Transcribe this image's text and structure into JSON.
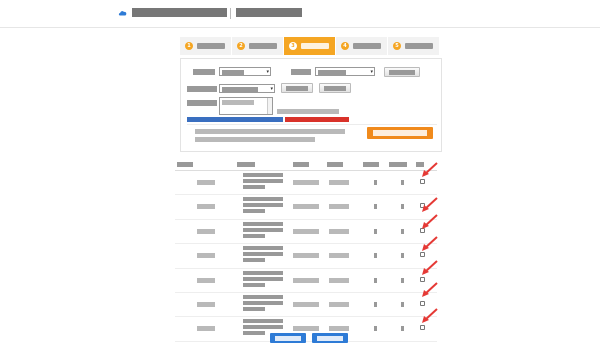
{
  "header": {
    "app_title": "",
    "page_subtitle": ""
  },
  "steps": [
    {
      "number": "1",
      "label": "",
      "active": false
    },
    {
      "number": "2",
      "label": "",
      "active": false
    },
    {
      "number": "3",
      "label": "",
      "active": true
    },
    {
      "number": "4",
      "label": "",
      "active": false
    },
    {
      "number": "5",
      "label": "",
      "active": false
    }
  ],
  "form": {
    "row1": {
      "label_a": "",
      "select_a": "",
      "label_b": "",
      "select_b": "",
      "button": ""
    },
    "row2": {
      "label": "",
      "select": "",
      "button_add": "",
      "button_remove": ""
    },
    "row3": {
      "label": "",
      "textarea": ""
    },
    "hints": {
      "small": "",
      "blue": "",
      "red": ""
    },
    "notes": [
      "",
      ""
    ],
    "submit_label": ""
  },
  "table": {
    "headers": [
      "",
      "",
      "",
      "",
      "",
      "",
      ""
    ],
    "rows": [
      {
        "id": "",
        "desc": [
          "",
          "",
          ""
        ],
        "date": "",
        "time": "",
        "n1": "",
        "n2": "",
        "checked": false
      },
      {
        "id": "",
        "desc": [
          "",
          "",
          ""
        ],
        "date": "",
        "time": "",
        "n1": "",
        "n2": "",
        "checked": false
      },
      {
        "id": "",
        "desc": [
          "",
          "",
          ""
        ],
        "date": "",
        "time": "",
        "n1": "",
        "n2": "",
        "checked": false
      },
      {
        "id": "",
        "desc": [
          "",
          "",
          ""
        ],
        "date": "",
        "time": "",
        "n1": "",
        "n2": "",
        "checked": false
      },
      {
        "id": "",
        "desc": [
          "",
          "",
          ""
        ],
        "date": "",
        "time": "",
        "n1": "",
        "n2": "",
        "checked": false
      },
      {
        "id": "",
        "desc": [
          "",
          "",
          ""
        ],
        "date": "",
        "time": "",
        "n1": "",
        "n2": "",
        "checked": false
      },
      {
        "id": "",
        "desc": [
          "",
          "",
          ""
        ],
        "date": "",
        "time": "",
        "n1": "",
        "n2": "",
        "checked": false
      }
    ]
  },
  "pager": {
    "prev_label": "",
    "next_label": ""
  },
  "icons": {
    "logo": "cloud-logo-icon",
    "dropdown": "chevron-down-icon",
    "pointer": "red-arrow-icon"
  },
  "colors": {
    "accent_orange": "#f08a1c",
    "step_active": "#f5a623",
    "link_blue": "#2e7bd6",
    "arrow_red": "#e53935",
    "alert_red": "#d9322a"
  }
}
